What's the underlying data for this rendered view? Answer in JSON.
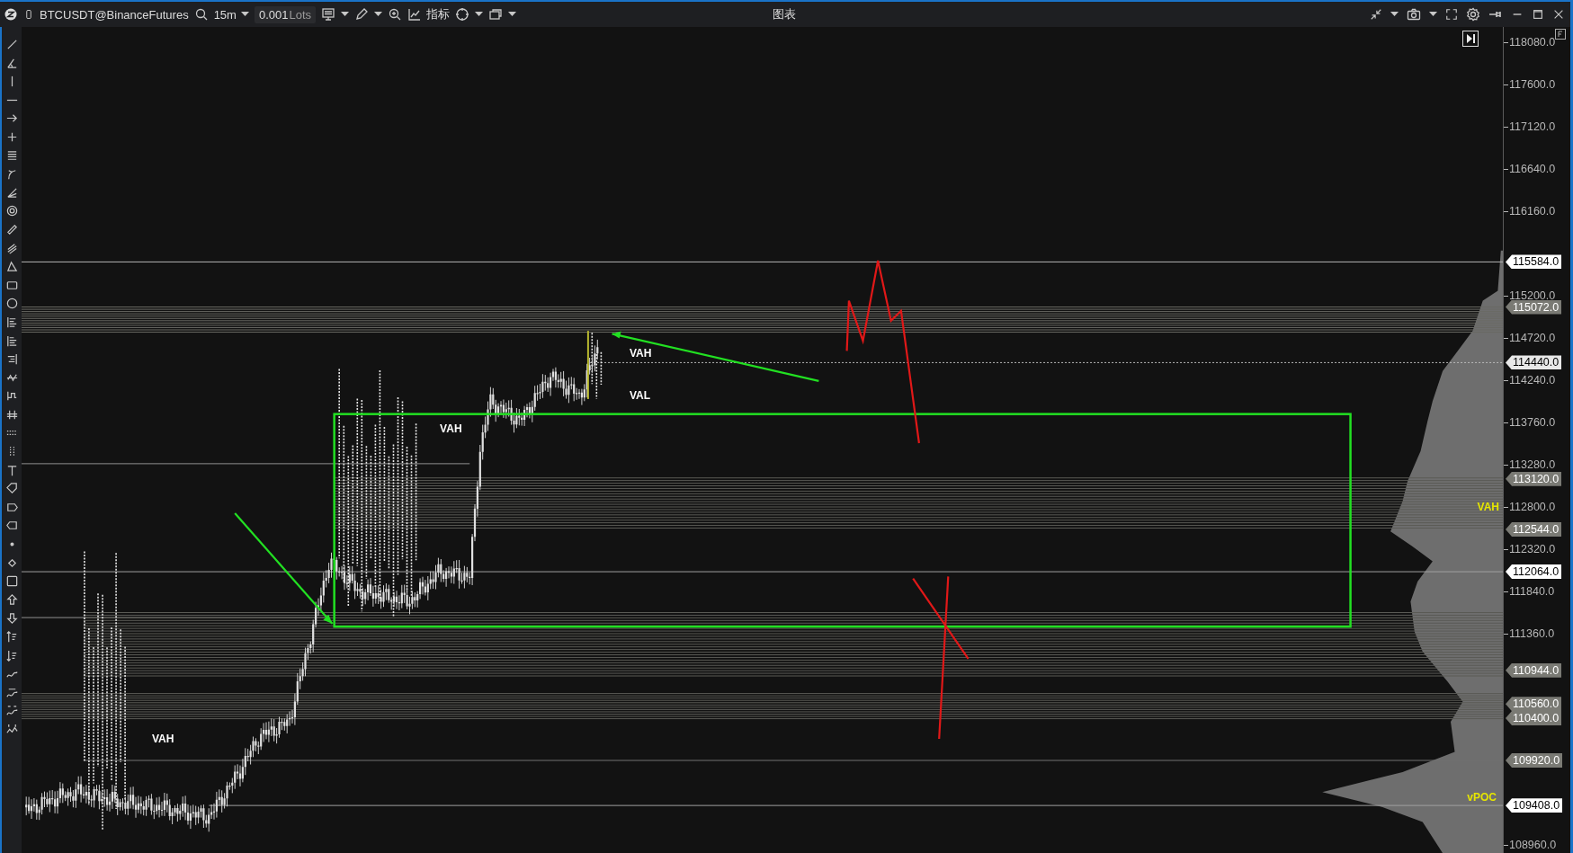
{
  "window": {
    "title": "图表"
  },
  "toolbar": {
    "symbol": "BTCUSDT@BinanceFutures",
    "timeframe": "15m",
    "quantity": {
      "value": "0.001",
      "unit": "Lots"
    },
    "indicators_label": "指标"
  },
  "chart": {
    "price_ticks": [
      "118080.0",
      "117600.0",
      "117120.0",
      "116640.0",
      "116160.0",
      "115200.0",
      "114720.0",
      "114240.0",
      "113760.0",
      "113280.0",
      "112800.0",
      "112320.0",
      "111840.0",
      "111360.0",
      "108960.0"
    ],
    "price_tags": [
      {
        "label": "115584.0",
        "color": "#ffffff"
      },
      {
        "label": "115072.0",
        "color": "#7a7a74"
      },
      {
        "label": "114440.0",
        "color": "#e8e8e8"
      },
      {
        "label": "113120.0",
        "color": "#7a7a74"
      },
      {
        "label": "112544.0",
        "color": "#7a7a74"
      },
      {
        "label": "112064.0",
        "color": "#ffffff"
      },
      {
        "label": "110944.0",
        "color": "#7a7a74"
      },
      {
        "label": "110560.0",
        "color": "#7a7a74"
      },
      {
        "label": "110400.0",
        "color": "#7a7a74"
      },
      {
        "label": "109920.0",
        "color": "#7a7a74"
      },
      {
        "label": "109408.0",
        "color": "#ffffff"
      }
    ],
    "profile_labels": [
      "VAH",
      "vPOC"
    ],
    "session_labels": [
      "VAH",
      "VAH",
      "VAH",
      "VAL"
    ]
  }
}
